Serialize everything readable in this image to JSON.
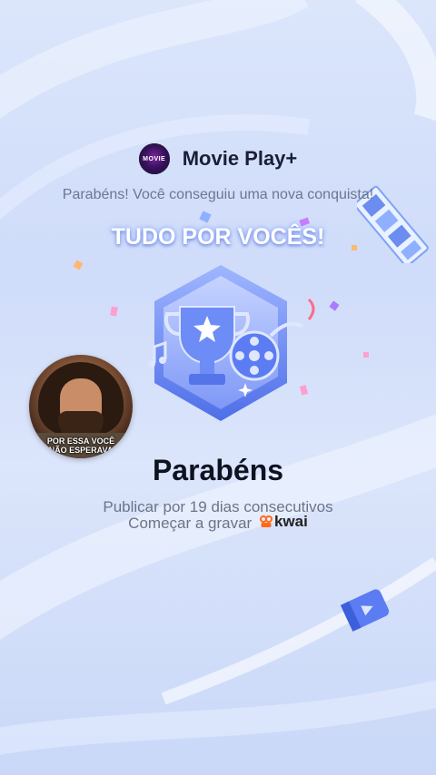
{
  "header": {
    "app_title": "Movie Play+",
    "logo_text": "MOVIE"
  },
  "subtitle": "Parabéns! Você conseguiu uma nova conquista!",
  "banner": "TUDO POR VOCÊS!",
  "avatar": {
    "caption_line1": "POR ESSA VOCÊ",
    "caption_line2": "NÃO ESPERAVA"
  },
  "achievement": {
    "title": "Parabéns",
    "description": "Publicar por 19 dias consecutivos",
    "cta_text": "Começar a gravar",
    "brand": "kwai"
  },
  "colors": {
    "badge_primary": "#5b7cf2",
    "badge_light": "#b9c8ff",
    "kwai_orange": "#ff6a1a"
  }
}
